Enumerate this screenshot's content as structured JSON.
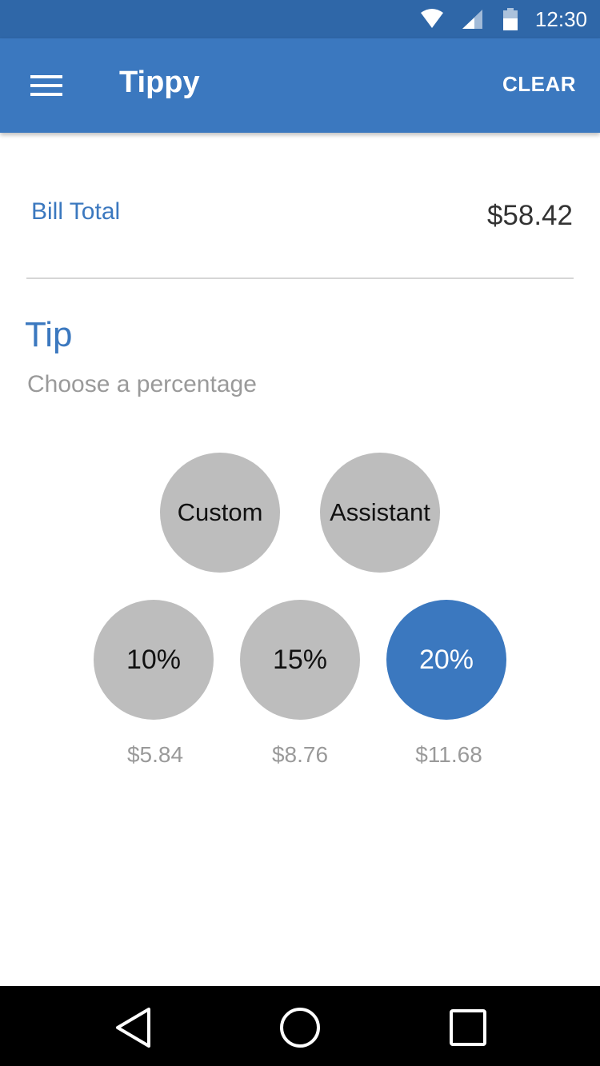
{
  "status_bar": {
    "time": "12:30",
    "icons": [
      "wifi-icon",
      "signal-icon",
      "battery-icon"
    ],
    "background": "#2f67a8"
  },
  "app_bar": {
    "title": "Tippy",
    "menu_icon": "hamburger-menu-icon",
    "clear_label": "CLEAR",
    "background": "#3b78bf"
  },
  "bill": {
    "label": "Bill Total",
    "value": "$58.42"
  },
  "tip": {
    "heading": "Tip",
    "subtitle": "Choose a percentage",
    "options_top": [
      {
        "label": "Custom"
      },
      {
        "label": "Assistant"
      }
    ],
    "options_bottom": [
      {
        "label": "10%",
        "amount": "$5.84",
        "selected": false
      },
      {
        "label": "15%",
        "amount": "$8.76",
        "selected": false
      },
      {
        "label": "20%",
        "amount": "$11.68",
        "selected": true
      }
    ]
  },
  "colors": {
    "accent": "#3b78bf",
    "unselected_circle": "#bdbdbd",
    "secondary_text": "#9a9a9a"
  },
  "nav_bar": {
    "icons": [
      "back-icon",
      "home-icon",
      "recents-icon"
    ]
  }
}
